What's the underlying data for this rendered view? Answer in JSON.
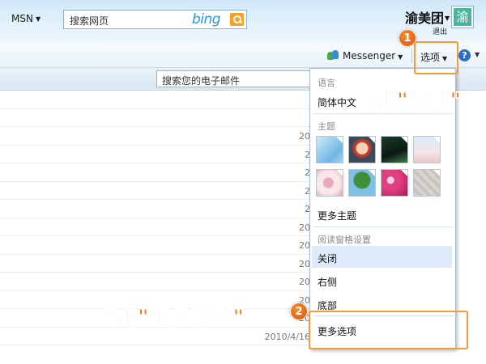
{
  "header": {
    "msn_label": "MSN",
    "search_placeholder": "搜索网页",
    "bing_logo": "bing",
    "user_name": "渝美团",
    "signout_label": "退出",
    "avatar_char": "渝"
  },
  "toolbar": {
    "messenger_label": "Messenger",
    "options_label": "选项",
    "help_label": "?"
  },
  "mail": {
    "search_placeholder": "搜索您的电子邮件",
    "rows": [
      {
        "date": ""
      },
      {
        "date": ""
      },
      {
        "date": "20"
      },
      {
        "date": "2"
      },
      {
        "date": "2"
      },
      {
        "date": "2"
      },
      {
        "date": "2"
      },
      {
        "date": "20"
      },
      {
        "date": "20"
      },
      {
        "date": "20"
      },
      {
        "date": "20"
      },
      {
        "date": "20"
      },
      {
        "date": "20"
      },
      {
        "date": "2010/4/16"
      }
    ]
  },
  "options_menu": {
    "language_header": "语言",
    "language_value": "简体中文",
    "theme_header": "主题",
    "more_themes": "更多主题",
    "reading_pane_header": "阅读窗格设置",
    "reading_off": "关闭",
    "reading_right": "右侧",
    "reading_bottom": "底部",
    "more_options": "更多选项"
  },
  "annotations": {
    "step1_number": "1",
    "step1_text": "点击\"选项\"",
    "step2_number": "2",
    "step2_text": "点击\"更多选项\""
  },
  "colors": {
    "annotation_orange": "#f27b1a",
    "selected_bg": "#dceaf9",
    "header_bg": "#cfe8f7"
  }
}
